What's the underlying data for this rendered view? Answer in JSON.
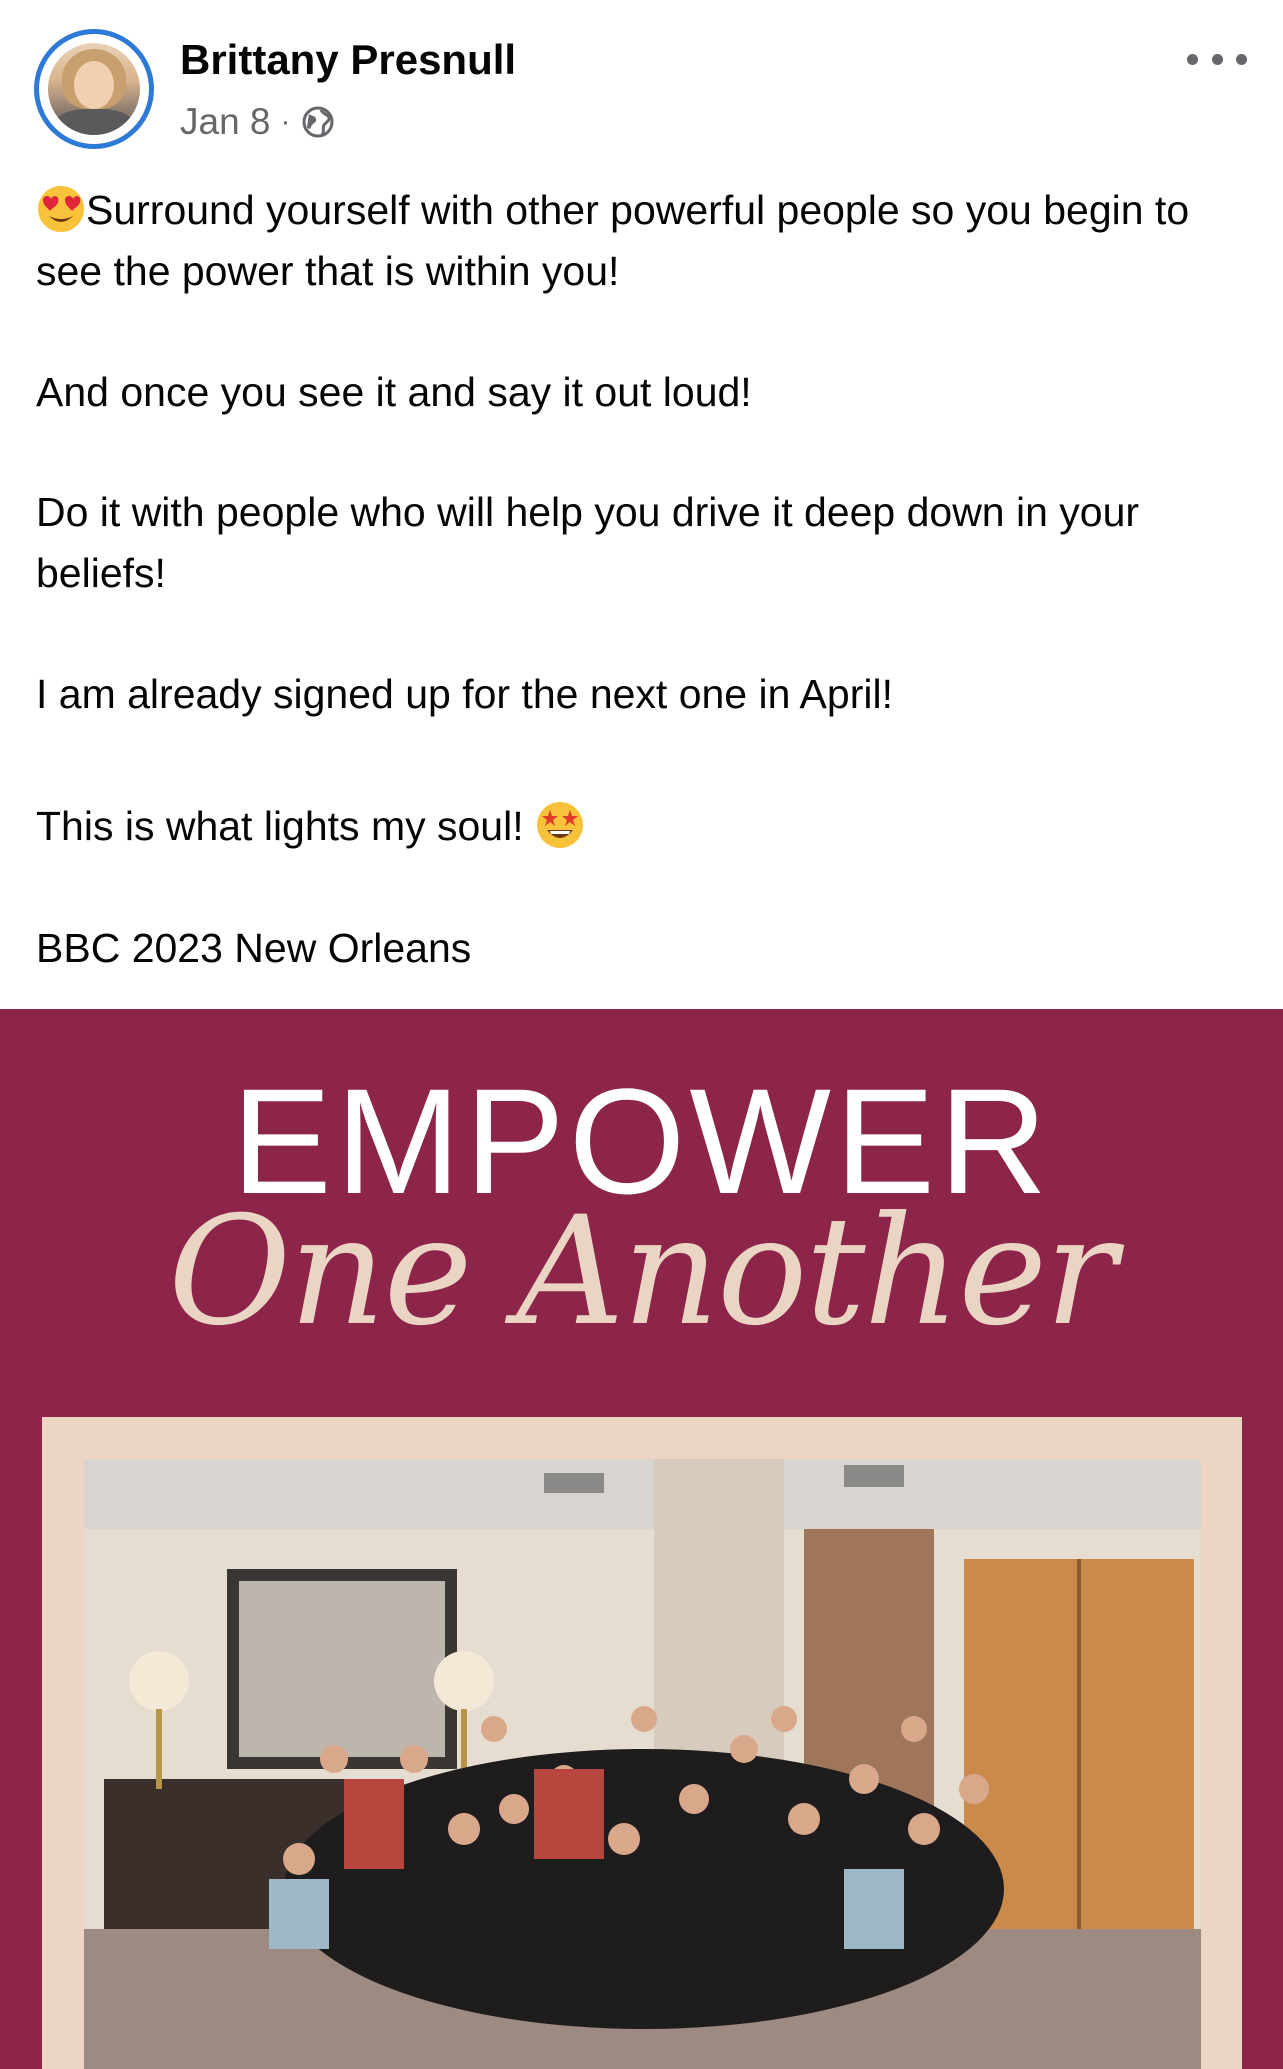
{
  "post": {
    "author": "Brittany Presnull",
    "date": "Jan 8",
    "separator": "·",
    "audience_icon": "globe-icon",
    "more_icon": "more-options-icon"
  },
  "content": {
    "paragraphs": [
      "Surround yourself with other powerful people so you begin to see the power that is within you!",
      "And once you see it and say it out loud!",
      "Do it with people who will help you drive it deep down in your beliefs!",
      "I am already signed up for the next one in April!",
      "This is what lights my soul!",
      "BBC 2023 New Orleans"
    ],
    "emojis": {
      "lead": "heart-eyes-emoji",
      "trailing": "star-struck-emoji"
    }
  },
  "image": {
    "headline": "EMPOWER",
    "script_line": "One Another",
    "background_color": "#8d244a",
    "frame_color": "#ecd5c3",
    "photo_description_icon": "group-photo"
  },
  "colors": {
    "avatar_ring": "#2d7ad6",
    "meta_text": "#65676b",
    "body_text": "#050505"
  }
}
